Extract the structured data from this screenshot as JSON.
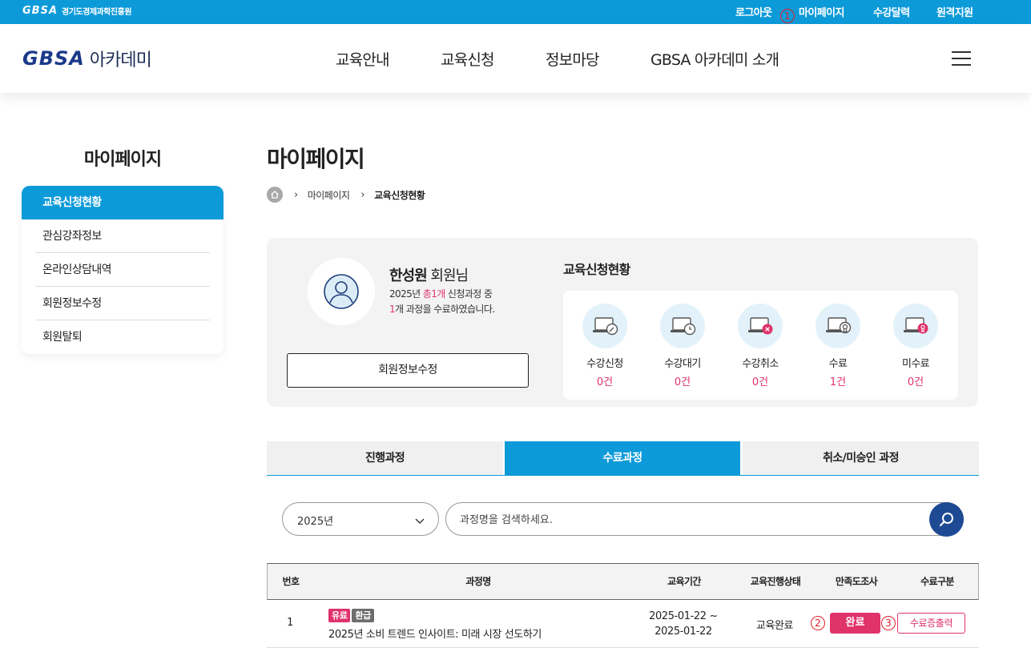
{
  "topbar": {
    "org_mark": "GBSA",
    "org_name": "경기도경제과학진흥원",
    "logout": "로그아웃",
    "mypage": "마이페이지",
    "history": "수강달력",
    "remote": "원격지원",
    "annotation_1": "①"
  },
  "header": {
    "logo_mark": "GBSA",
    "logo_name": "아카데미",
    "menu": [
      "교육안내",
      "교육신청",
      "정보마당",
      "GBSA 아카데미 소개"
    ]
  },
  "sidebar": {
    "title": "마이페이지",
    "items": [
      "교육신청현황",
      "관심강좌정보",
      "온라인상담내역",
      "회원정보수정",
      "회원탈퇴"
    ]
  },
  "page": {
    "title": "마이페이지",
    "breadcrumb": [
      "마이페이지",
      "교육신청현황"
    ]
  },
  "summary": {
    "user_name": "한성원",
    "user_suffix": " 회원님",
    "line1_prefix": "2025년 ",
    "line1_highlight": "총1개",
    "line1_suffix": " 신청과정 중",
    "line2_highlight": "1",
    "line2_suffix": "개 과정을 수료하였습니다.",
    "edit_button": "회원정보수정",
    "status_title": "교육신청현황",
    "stats": [
      {
        "label": "수강신청",
        "count": "0건",
        "icon": "laptop-pen-icon"
      },
      {
        "label": "수강대기",
        "count": "0건",
        "icon": "laptop-clock-icon"
      },
      {
        "label": "수강취소",
        "count": "0건",
        "icon": "laptop-cancel-icon"
      },
      {
        "label": "수료",
        "count": "1건",
        "icon": "laptop-medal-icon"
      },
      {
        "label": "미수료",
        "count": "0건",
        "icon": "laptop-alert-icon"
      }
    ]
  },
  "tabs": [
    "진행과정",
    "수료과정",
    "취소/미승인 과정"
  ],
  "active_tab": "수료과정",
  "filter": {
    "year": "2025년",
    "search_placeholder": "과정명을 검색하세요."
  },
  "table": {
    "headers": [
      "번호",
      "과정명",
      "교육기간",
      "교육진행상태",
      "만족도조사",
      "수료구분"
    ],
    "rows": [
      {
        "no": "1",
        "badges": [
          "유료",
          "환급"
        ],
        "course": "2025년 소비 트렌드 인사이트: 미래 시장 선도하기",
        "period_start": "2025-01-22 ~",
        "period_end": "2025-01-22",
        "status": "교육완료",
        "survey": "완료",
        "certificate": "수료증출력",
        "annotation_2": "②",
        "annotation_3": "③"
      }
    ]
  },
  "colors": {
    "primary": "#0c9ad9",
    "navy": "#1e4a93",
    "accent": "#e0336b"
  }
}
